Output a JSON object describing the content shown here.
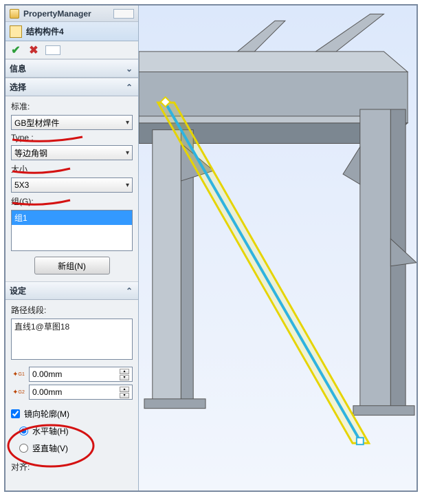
{
  "header": {
    "title": "PropertyManager"
  },
  "feature": {
    "name": "结构构件4"
  },
  "sections": {
    "info": {
      "title": "信息"
    },
    "select": {
      "title": "选择",
      "standard_label": "标准:",
      "standard_value": "GB型材焊件",
      "type_label": "Type :",
      "type_value": "等边角钢",
      "size_label": "大小",
      "size_value": "5X3",
      "group_label": "组(G):",
      "group_items": [
        "组1"
      ],
      "new_group_btn": "新组(N)"
    },
    "settings": {
      "title": "设定",
      "path_label": "路径线段:",
      "path_items": [
        "直线1@草图18"
      ],
      "offset1": "0.00mm",
      "offset2": "0.00mm",
      "mirror_label": "镜向轮廓(M)",
      "mirror_checked": true,
      "horiz_label": "水平轴(H)",
      "vert_label": "竖直轴(V)",
      "axis_selected": "horiz",
      "align_label": "对齐:"
    }
  },
  "colors": {
    "panel_border": "#7a8aa0",
    "highlight": "#3399ff",
    "red_annot": "#d41111",
    "steel_light": "#c9d1d9",
    "steel_mid": "#a8b2bc",
    "steel_dark": "#7c8791",
    "sel_yellow": "#fff400",
    "sel_cyan": "#2fb3e0"
  }
}
